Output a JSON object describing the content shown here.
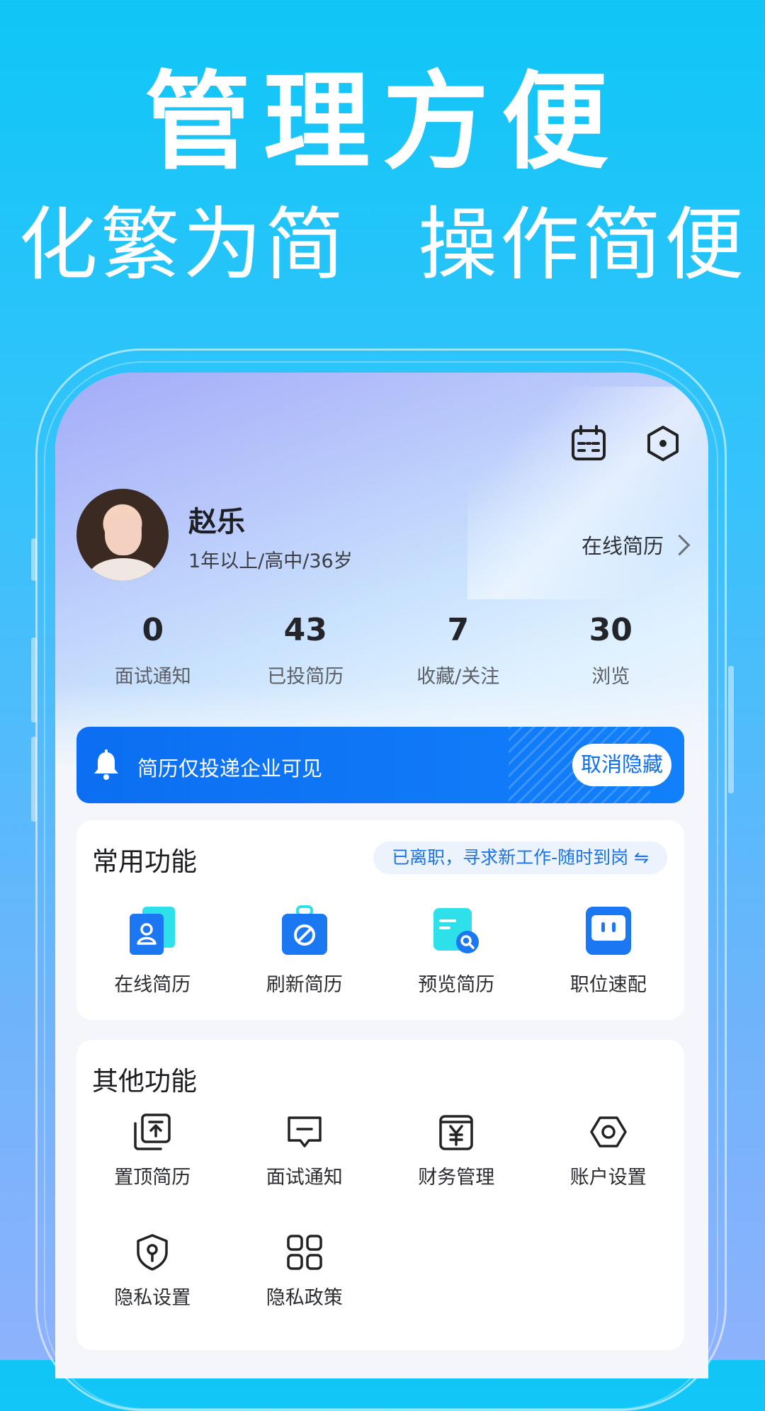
{
  "promo": {
    "title": "管理方便",
    "subtitle_left": "化繁为简",
    "subtitle_right": "操作简便"
  },
  "header": {
    "icons": [
      "calendar-icon",
      "settings-icon"
    ]
  },
  "profile": {
    "name": "赵乐",
    "meta": "1年以上/高中/36岁",
    "link_label": "在线简历"
  },
  "stats": [
    {
      "value": "0",
      "label": "面试通知"
    },
    {
      "value": "43",
      "label": "已投简历"
    },
    {
      "value": "7",
      "label": "收藏/关注"
    },
    {
      "value": "30",
      "label": "浏览"
    }
  ],
  "privacy": {
    "text": "简历仅投递企业可见",
    "button": "取消隐藏"
  },
  "common": {
    "title": "常用功能",
    "status": "已离职，寻求新工作-随时到岗 ⇋",
    "items": [
      {
        "label": "在线简历",
        "icon": "resume-icon"
      },
      {
        "label": "刷新简历",
        "icon": "refresh-icon"
      },
      {
        "label": "预览简历",
        "icon": "preview-icon"
      },
      {
        "label": "职位速配",
        "icon": "match-icon"
      }
    ]
  },
  "other": {
    "title": "其他功能",
    "items": [
      {
        "label": "置顶简历",
        "icon": "pin-top-icon"
      },
      {
        "label": "面试通知",
        "icon": "message-icon"
      },
      {
        "label": "财务管理",
        "icon": "finance-icon"
      },
      {
        "label": "账户设置",
        "icon": "account-settings-icon"
      },
      {
        "label": "隐私设置",
        "icon": "privacy-shield-icon"
      },
      {
        "label": "隐私政策",
        "icon": "grid-apps-icon"
      }
    ]
  },
  "colors": {
    "background_top": "#0fc6f7",
    "background_bottom": "#8eb2fc",
    "accent": "#0c6ef2",
    "status_text": "#1a74e8"
  }
}
